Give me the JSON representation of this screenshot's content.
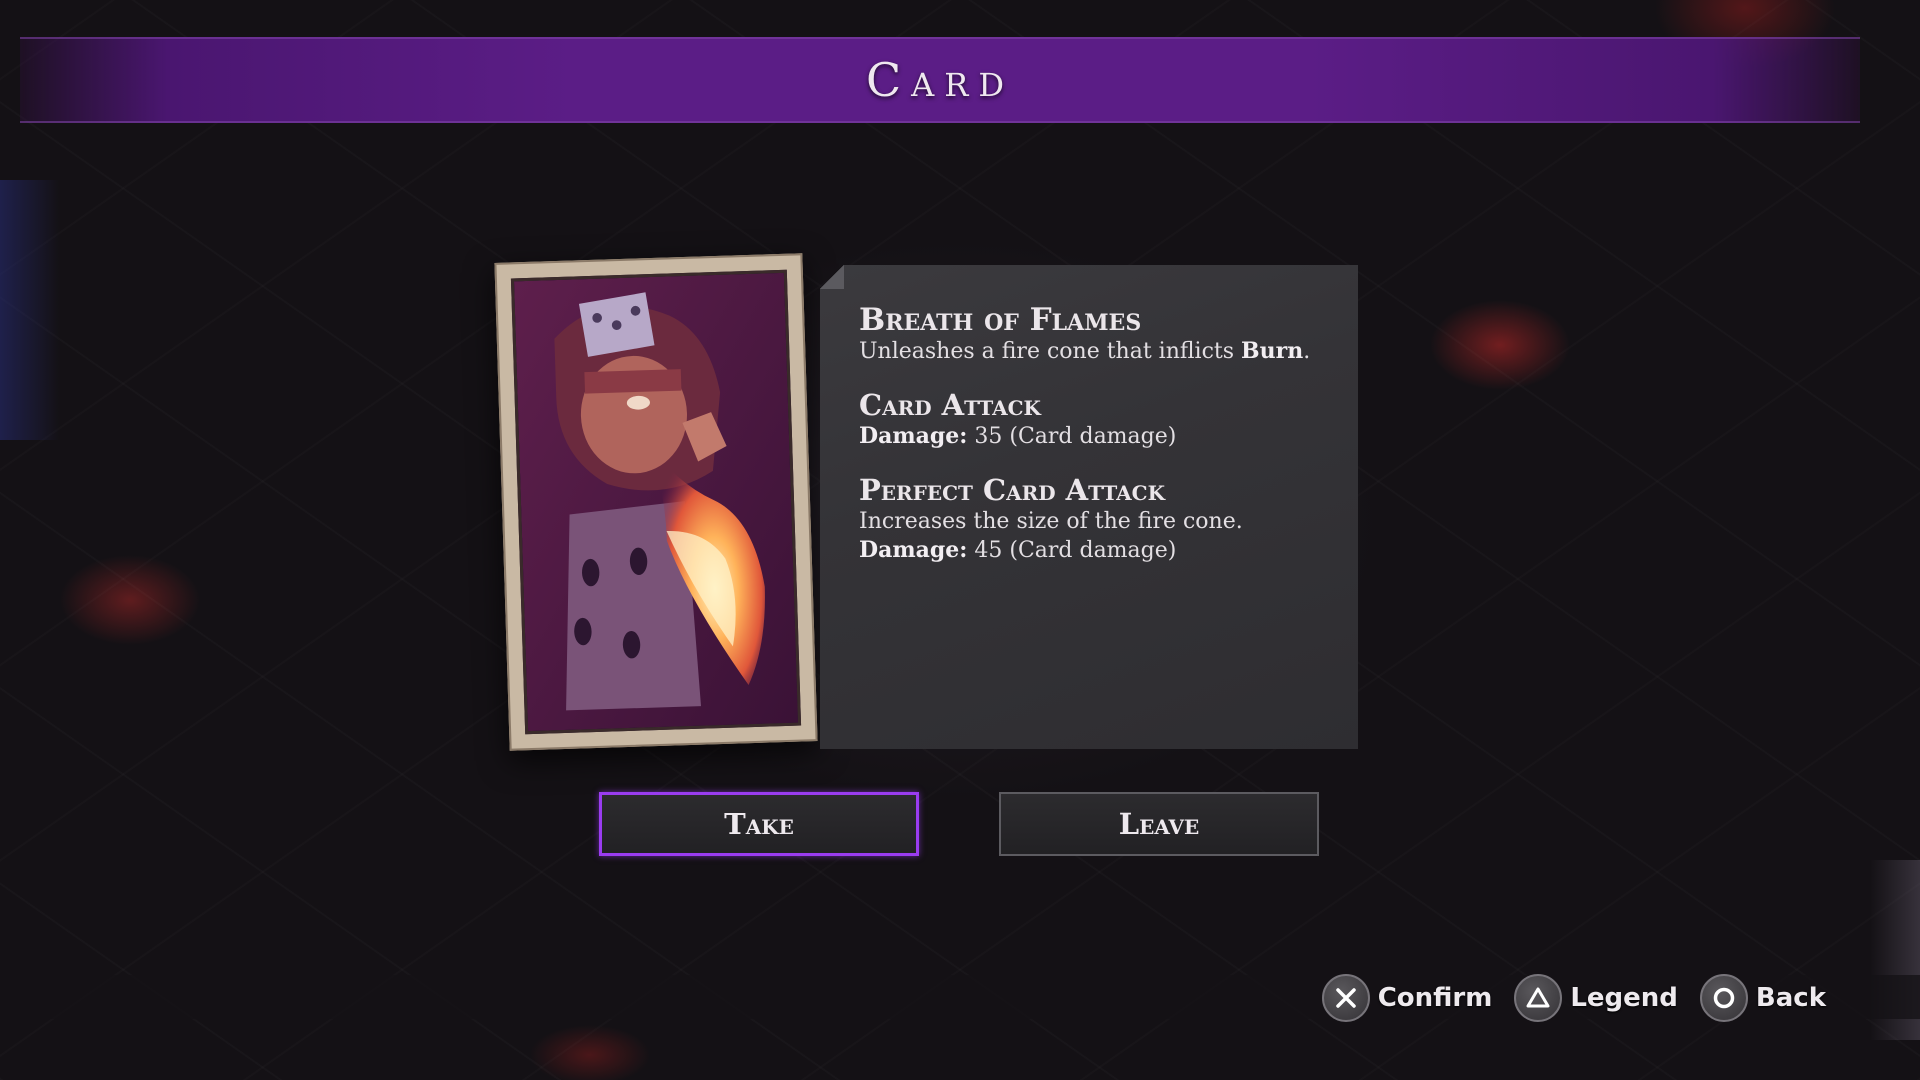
{
  "title": "Card",
  "card": {
    "art": "breath-of-flames-card-art",
    "name": "Breath of Flames",
    "description_prefix": "Unleashes a fire cone that inflicts ",
    "description_keyword": "Burn",
    "description_suffix": ".",
    "attack": {
      "title": "Card Attack",
      "damage_label": "Damage:",
      "damage_value": " 35 (Card damage)"
    },
    "perfect_attack": {
      "title": "Perfect Card Attack",
      "effect": "Increases the size of the fire cone.",
      "damage_label": "Damage:",
      "damage_value": " 45 (Card damage)"
    }
  },
  "buttons": {
    "take": "Take",
    "leave": "Leave"
  },
  "prompts": [
    {
      "icon": "cross-button-icon",
      "label": "Confirm"
    },
    {
      "icon": "triangle-button-icon",
      "label": "Legend"
    },
    {
      "icon": "circle-button-icon",
      "label": "Back"
    }
  ],
  "colors": {
    "banner": "#5b1d86",
    "selected_button_border": "#9a3cf0",
    "panel": "#353438"
  }
}
